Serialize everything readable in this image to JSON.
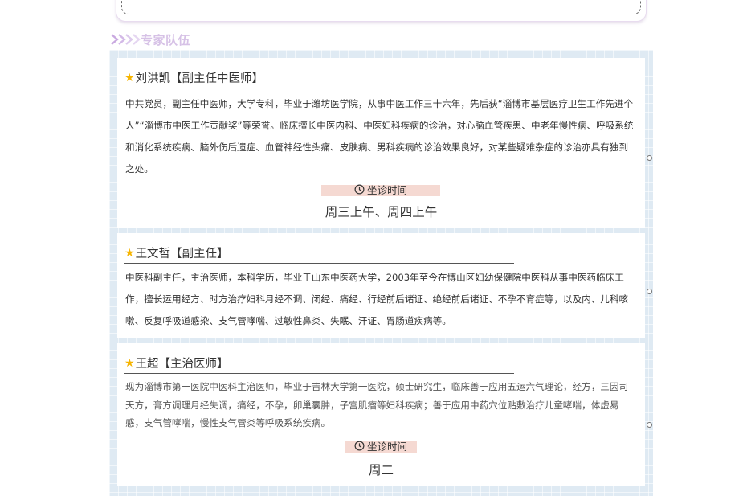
{
  "section": {
    "title": "专家队伍",
    "title_color": "#d6c1e6",
    "chevron_color": "#c9a9e0",
    "panel_color": "#dfeaf3"
  },
  "doctors": [
    {
      "name": "刘洪凯【副主任中医师】",
      "bio": "中共党员，副主任中医师，大学专科，毕业于潍坊医学院，从事中医工作三十六年，先后获“淄博市基层医疗卫生工作先进个人”“淄博市中医工作贡献奖”等荣誉。临床擅长中医内科、中医妇科疾病的诊治，对心脑血管疾患、中老年慢性病、呼吸系统和消化系统疾病、脑外伤后遗症、血管神经性头痛、皮肤病、男科疾病的诊治效果良好，对某些疑难杂症的诊治亦具有独到之处。",
      "time_label": "坐诊时间",
      "schedule": "周三上午、周四上午"
    },
    {
      "name": "王文哲【副主任】",
      "bio": "中医科副主任，主治医师，本科学历，毕业于山东中医药大学，2003年至今在博山区妇幼保健院中医科从事中医药临床工作，擅长运用经方、时方治疗妇科月经不调、闭经、痛经、行经前后诸证、绝经前后诸证、不孕不育症等，以及内、儿科咳嗽、反复呼吸道感染、支气管哮喘、过敏性鼻炎、失眠、汗证、胃肠道疾病等。"
    },
    {
      "name": "王超【主治医师】",
      "bio": "现为淄博市第一医院中医科主治医师，毕业于吉林大学第一医院，硕士研究生，临床善于应用五运六气理论，经方，三因司天方，膏方调理月经失调，痛经，不孕，卵巢囊肿，子宫肌瘤等妇科疾病；善于应用中药穴位贴敷治疗儿童哮喘，体虚易感，支气管哮喘，慢性支气管炎等呼吸系统疾病。",
      "time_label": "坐诊时间",
      "schedule": "周二"
    }
  ],
  "icons": {
    "star": "star-icon",
    "clock": "clock-icon",
    "chevrons": "triple-chevron-icon"
  },
  "accent_colors": {
    "star": "#f6b400",
    "time_label_bg": "#f5d9d2"
  }
}
